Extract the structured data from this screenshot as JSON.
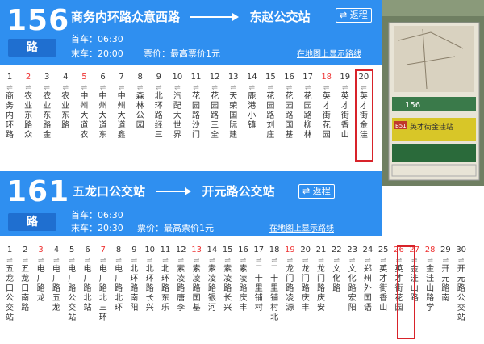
{
  "panel1": {
    "number": "156",
    "lu": "路",
    "from": "商务内环路众意西路",
    "to": "东赵公交站",
    "reverse": "⇄ 返程",
    "first_bus": "首车：06:30",
    "last_bus": "末车：20:00",
    "fare": "票价：最高票价1元",
    "map_link": "在地图上显示路线",
    "stops": [
      {
        "n": "1",
        "red": false,
        "name": "商务内环路"
      },
      {
        "n": "2",
        "red": true,
        "name": "农业东路众"
      },
      {
        "n": "3",
        "red": false,
        "name": "农业东路金"
      },
      {
        "n": "4",
        "red": false,
        "name": "农业东路"
      },
      {
        "n": "5",
        "red": true,
        "name": "中州大道农"
      },
      {
        "n": "6",
        "red": false,
        "name": "中州大道东"
      },
      {
        "n": "7",
        "red": false,
        "name": "中州大道鑫"
      },
      {
        "n": "8",
        "red": false,
        "name": "森林公园"
      },
      {
        "n": "9",
        "red": false,
        "name": "北环路经三"
      },
      {
        "n": "10",
        "red": false,
        "name": "汽配大世界"
      },
      {
        "n": "11",
        "red": false,
        "name": "花园路沙门"
      },
      {
        "n": "12",
        "red": false,
        "name": "花园路三全"
      },
      {
        "n": "13",
        "red": false,
        "name": "天荣国际建"
      },
      {
        "n": "14",
        "red": false,
        "name": "鹿港小镇"
      },
      {
        "n": "15",
        "red": false,
        "name": "花园路刘庄"
      },
      {
        "n": "16",
        "red": false,
        "name": "花园路国基"
      },
      {
        "n": "17",
        "red": false,
        "name": "花园路柳林"
      },
      {
        "n": "18",
        "red": true,
        "name": "英才街花园"
      },
      {
        "n": "19",
        "red": false,
        "name": "英才街香山"
      },
      {
        "n": "20",
        "red": false,
        "name": "英才街金洼"
      }
    ]
  },
  "panel2": {
    "number": "161",
    "lu": "路",
    "from": "五龙口公交站",
    "to": "开元路公交站",
    "reverse": "⇄ 返程",
    "first_bus": "首车：06:30",
    "last_bus": "末车：20:30",
    "fare": "票价：最高票价1元",
    "map_link": "在地图上显示路线",
    "stops": [
      {
        "n": "1",
        "red": false,
        "name": "五龙口公交站"
      },
      {
        "n": "2",
        "red": false,
        "name": "五龙口南路"
      },
      {
        "n": "3",
        "red": true,
        "name": "电厂路龙"
      },
      {
        "n": "4",
        "red": false,
        "name": "电厂路五龙"
      },
      {
        "n": "5",
        "red": false,
        "name": "电厂路公交站"
      },
      {
        "n": "6",
        "red": false,
        "name": "电厂路北站"
      },
      {
        "n": "7",
        "red": true,
        "name": "电厂路北三环"
      },
      {
        "n": "8",
        "red": false,
        "name": "电厂路北环"
      },
      {
        "n": "9",
        "red": false,
        "name": "北环路南阳"
      },
      {
        "n": "10",
        "red": false,
        "name": "北环路长兴"
      },
      {
        "n": "11",
        "red": false,
        "name": "北环路东乐"
      },
      {
        "n": "12",
        "red": false,
        "name": "素凌路唐李"
      },
      {
        "n": "13",
        "red": true,
        "name": "素凌路国基"
      },
      {
        "n": "14",
        "red": false,
        "name": "素凌路银河"
      },
      {
        "n": "15",
        "red": false,
        "name": "素凌路长兴"
      },
      {
        "n": "16",
        "red": false,
        "name": "素凌路庆丰"
      },
      {
        "n": "17",
        "red": false,
        "name": "二十里铺村"
      },
      {
        "n": "18",
        "red": false,
        "name": "二十里铺村北"
      },
      {
        "n": "19",
        "red": true,
        "name": "龙门路凌源"
      },
      {
        "n": "20",
        "red": false,
        "name": "龙门路庆丰"
      },
      {
        "n": "21",
        "red": false,
        "name": "龙门路庆安"
      },
      {
        "n": "22",
        "red": false,
        "name": "文化路"
      },
      {
        "n": "23",
        "red": false,
        "name": "文化路宏阳"
      },
      {
        "n": "24",
        "red": false,
        "name": "郑州外国语"
      },
      {
        "n": "25",
        "red": false,
        "name": "英才街香山"
      },
      {
        "n": "26",
        "red": true,
        "name": "英才街花园"
      },
      {
        "n": "27",
        "red": true,
        "name": "金洼山路"
      },
      {
        "n": "28",
        "red": true,
        "name": "金洼山路学"
      },
      {
        "n": "29",
        "red": false,
        "name": "开元路南"
      },
      {
        "n": "30",
        "red": false,
        "name": "开元路公交站"
      }
    ]
  },
  "photo": {
    "sign_number": "156",
    "sign_number2": "B51",
    "sign_title": "英才街金洼站"
  }
}
